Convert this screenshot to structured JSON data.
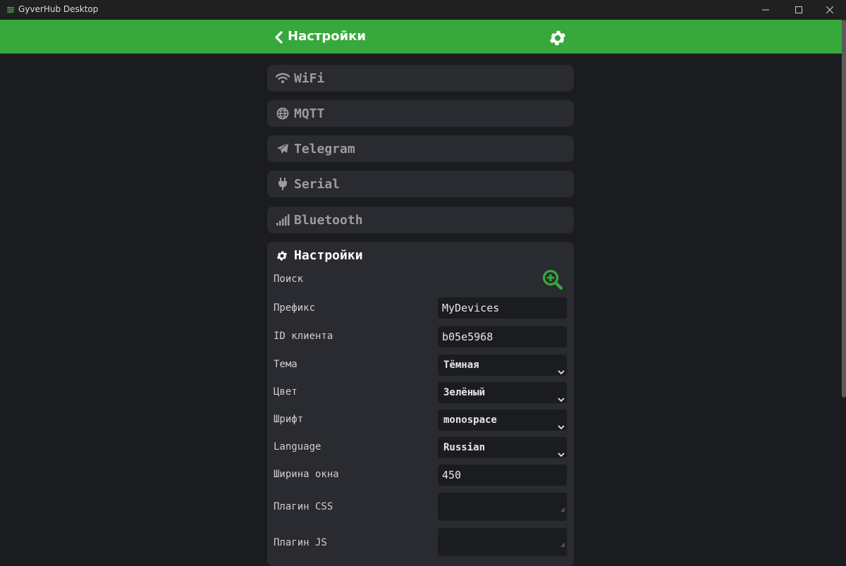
{
  "window": {
    "title": "GyverHub Desktop"
  },
  "header": {
    "title": "Настройки"
  },
  "sections": [
    {
      "label": "WiFi",
      "icon": "wifi-icon"
    },
    {
      "label": "MQTT",
      "icon": "globe-icon"
    },
    {
      "label": "Telegram",
      "icon": "paper-plane-icon"
    },
    {
      "label": "Serial",
      "icon": "plug-icon"
    },
    {
      "label": "Bluetooth",
      "icon": "signal-bars-icon"
    }
  ],
  "settings": {
    "title": "Настройки",
    "search_label": "Поиск",
    "prefix_label": "Префикс",
    "prefix_value": "MyDevices",
    "client_id_label": "ID клиента",
    "client_id_value": "b05e5968",
    "theme_label": "Тема",
    "theme_value": "Тёмная",
    "color_label": "Цвет",
    "color_value": "Зелёный",
    "font_label": "Шрифт",
    "font_value": "monospace",
    "language_label": "Language",
    "language_value": "Russian",
    "width_label": "Ширина окна",
    "width_value": "450",
    "plugin_css_label": "Плагин CSS",
    "plugin_js_label": "Плагин JS"
  },
  "colors": {
    "accent": "#37a93c",
    "background": "#1b1c20",
    "panel": "#2a2b30"
  }
}
